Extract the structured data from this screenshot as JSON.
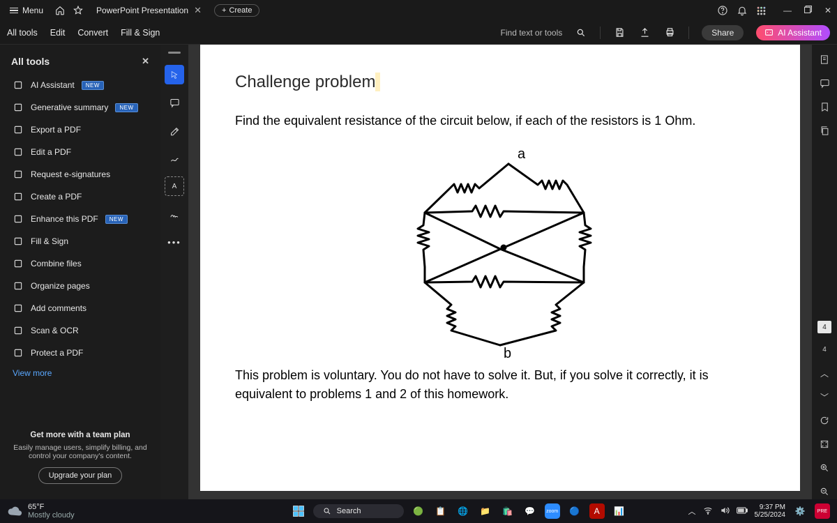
{
  "topbar": {
    "menu": "Menu",
    "tab_title": "PowerPoint Presentation",
    "create": "Create"
  },
  "toolbar": {
    "all_tools": "All tools",
    "edit": "Edit",
    "convert": "Convert",
    "fill_sign": "Fill & Sign",
    "find": "Find text or tools",
    "share": "Share",
    "ai": "AI Assistant"
  },
  "sidebar": {
    "title": "All tools",
    "new_badge": "NEW",
    "items": [
      {
        "label": "AI Assistant",
        "badge": true,
        "color": "#b86dff"
      },
      {
        "label": "Generative summary",
        "badge": true,
        "color": "#b86dff"
      },
      {
        "label": "Export a PDF",
        "badge": false,
        "color": "#ff5c8a"
      },
      {
        "label": "Edit a PDF",
        "badge": false,
        "color": "#c86dd7"
      },
      {
        "label": "Request e-signatures",
        "badge": false,
        "color": "#b8a0d9"
      },
      {
        "label": "Create a PDF",
        "badge": false,
        "color": "#ff6b7a"
      },
      {
        "label": "Enhance this PDF",
        "badge": true,
        "color": "#5da8ff"
      },
      {
        "label": "Fill & Sign",
        "badge": false,
        "color": "#7cc5a8"
      },
      {
        "label": "Combine files",
        "badge": false,
        "color": "#8a7fd6"
      },
      {
        "label": "Organize pages",
        "badge": false,
        "color": "#d6a85f"
      },
      {
        "label": "Add comments",
        "badge": false,
        "color": "#c9b87a"
      },
      {
        "label": "Scan & OCR",
        "badge": false,
        "color": "#7cc5a8"
      },
      {
        "label": "Protect a PDF",
        "badge": false,
        "color": "#5db8d6"
      }
    ],
    "view_more": "View more",
    "promo_title": "Get more with a team plan",
    "promo_body": "Easily manage users, simplify billing, and control your company's content.",
    "promo_btn": "Upgrade your plan"
  },
  "document": {
    "title": "Challenge problem",
    "para1": "Find the equivalent resistance of the circuit below, if each of the resistors is 1 Ohm.",
    "label_a": "a",
    "label_b": "b",
    "para2": "This problem is voluntary. You do not have to solve it. But, if you solve it correctly, it is equivalent to problems 1 and 2 of this homework."
  },
  "taskbar": {
    "temp": "65°F",
    "cond": "Mostly cloudy",
    "search": "Search",
    "time": "9:37 PM",
    "date": "5/25/2024"
  },
  "page_indicator": {
    "cur": "4",
    "tot": "4"
  }
}
